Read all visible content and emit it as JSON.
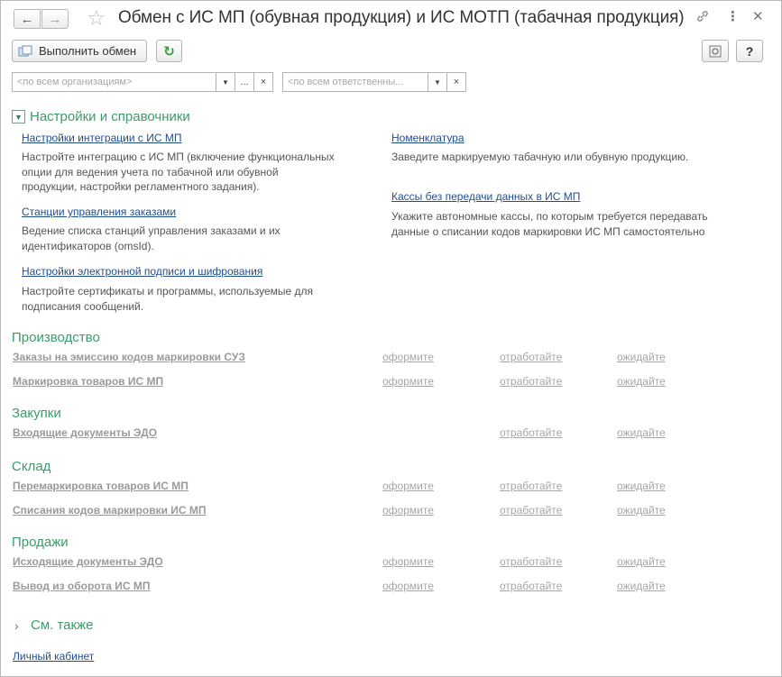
{
  "window": {
    "title": "Обмен с ИС МП (обувная продукция) и ИС МОТП (табачная продукция)"
  },
  "toolbar": {
    "exchange_label": "Выполнить обмен",
    "help_label": "?"
  },
  "filters": {
    "organization_placeholder": "<по всем организациям>",
    "responsible_placeholder": "<по всем ответственны...",
    "select_label": "..."
  },
  "settings_section": {
    "title": "Настройки и справочники",
    "left": [
      {
        "link": "Настройки интеграции с ИС МП",
        "desc_lines": [
          "Настройте интеграцию с ИС МП (включение функциональных",
          "опции для ведения учета по табачной или обувной",
          "продукции, настройки регламентного задания)."
        ]
      },
      {
        "link": "Станции управления заказами",
        "desc_lines": [
          "Ведение списка станций управления заказами и их",
          "идентификаторов (omsId)."
        ]
      },
      {
        "link": "Настройки электронной подписи и шифрования",
        "desc_lines": [
          "Настройте сертификаты и программы, используемые для",
          "подписания сообщений."
        ]
      }
    ],
    "right": [
      {
        "link": "Номенклатура",
        "desc_lines": [
          "Заведите маркируемую табачную или обувную продукцию."
        ]
      },
      {
        "link": "Кассы без передачи данных в ИС МП",
        "desc_lines": [
          "Укажите автономные кассы, по которым требуется передавать",
          "данные о списании кодов маркировки ИС МП самостоятельно"
        ]
      }
    ]
  },
  "status_labels": {
    "draft": "оформите",
    "process": "отработайте",
    "wait": "ожидайте"
  },
  "groups": [
    {
      "title": "Производство",
      "items": [
        {
          "label": "Заказы на эмиссию кодов маркировки СУЗ",
          "draft": "оформите",
          "process": "отработайте",
          "wait": "ожидайте"
        },
        {
          "label": "Маркировка товаров ИС МП",
          "draft": "оформите",
          "process": "отработайте",
          "wait": "ожидайте"
        }
      ]
    },
    {
      "title": "Закупки",
      "items": [
        {
          "label": "Входящие документы ЭДО",
          "draft": "",
          "process": "отработайте",
          "wait": "ожидайте"
        }
      ]
    },
    {
      "title": "Склад",
      "items": [
        {
          "label": "Перемаркировка товаров ИС МП",
          "draft": "оформите",
          "process": "отработайте",
          "wait": "ожидайте"
        },
        {
          "label": "Списания кодов маркировки ИС МП",
          "draft": "оформите",
          "process": "отработайте",
          "wait": "ожидайте"
        }
      ]
    },
    {
      "title": "Продажи",
      "items": [
        {
          "label": "Исходящие документы ЭДО",
          "draft": "оформите",
          "process": "отработайте",
          "wait": "ожидайте"
        },
        {
          "label": "Вывод из оборота ИС МП",
          "draft": "оформите",
          "process": "отработайте",
          "wait": "ожидайте"
        }
      ]
    }
  ],
  "see_also": {
    "title": "См. также"
  },
  "footer": {
    "cabinet_link": "Личный кабинет"
  },
  "colors": {
    "section_green": "#3c9b6b",
    "link_blue": "#1f4f8f",
    "disabled_gray": "#a6a6a6"
  }
}
